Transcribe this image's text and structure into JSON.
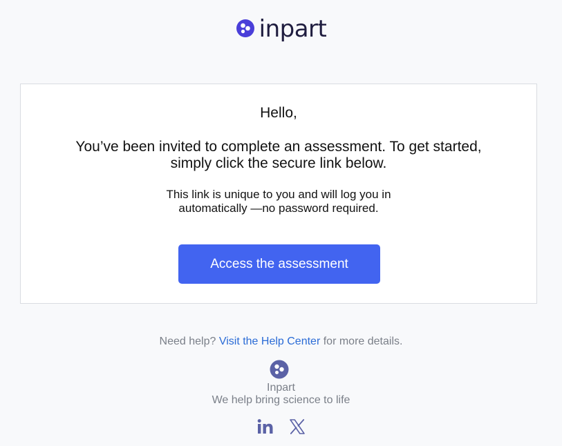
{
  "brand": {
    "logo_text": "inpart",
    "logo_icon": "inpart-logo-icon",
    "colors": {
      "mark": "#4a3fd9",
      "wordmark": "#1f1d3f",
      "accent": "#4264f0",
      "link": "#2a6bd6",
      "footer_mark": "#5b62a6"
    }
  },
  "email": {
    "greeting": "Hello,",
    "intro_line1": "You’ve been invited to complete an assessment. To get started,",
    "intro_line2": "simply click the secure link below.",
    "note_line1": "This link is unique to you and will log you in",
    "note_line2": "automatically —no password required.",
    "cta_label": "Access the assessment"
  },
  "footer": {
    "help_prefix": "Need help?",
    "help_link": "Visit the Help Center",
    "help_suffix": "for more details.",
    "company": "Inpart",
    "tagline": "We help bring science to life",
    "social": [
      {
        "icon": "linkedin-icon"
      },
      {
        "icon": "x-twitter-icon"
      }
    ]
  }
}
